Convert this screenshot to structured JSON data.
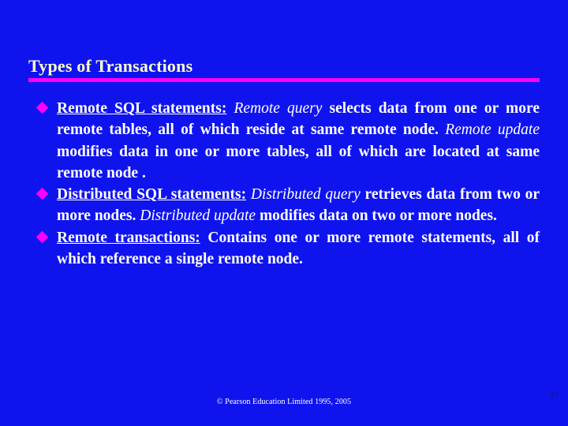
{
  "slide": {
    "background_color": "#0f14ef",
    "title": "Types of Transactions",
    "title_color": "#ffffcc",
    "rule_color": "#ff00ff",
    "bullet_marker_color": "#ff00ff",
    "body_text_color": "#ffffff",
    "bullets": [
      {
        "marker": "diamond-bullet",
        "term": "Remote  SQL  statements",
        "term_suffix": ":",
        "segments": [
          {
            "text": "Remote query",
            "style": "italic"
          },
          {
            "text": " selects data from one or more remote tables, all of which reside at same remote node. ",
            "style": "normal"
          },
          {
            "text": "Remote update",
            "style": "italic"
          },
          {
            "text": " modifies data in one or more tables, all of which are located at same remote node .",
            "style": "normal"
          }
        ]
      },
      {
        "marker": "diamond-bullet",
        "term": "Distributed  SQL  statements",
        "term_suffix": ":",
        "segments": [
          {
            "text": "Distributed query",
            "style": "italic"
          },
          {
            "text": " retrieves data from two or more nodes. ",
            "style": "normal"
          },
          {
            "text": "Distributed update",
            "style": "italic"
          },
          {
            "text": " modifies data on two or more nodes.",
            "style": "normal"
          }
        ]
      },
      {
        "marker": "diamond-bullet",
        "term": "Remote  transactions",
        "term_suffix": ":",
        "segments": [
          {
            "text": " Contains one or more remote statements, all of which reference a single remote node.",
            "style": "normal"
          }
        ]
      }
    ],
    "footer": {
      "copyright": "© Pearson Education Limited 1995, 2005",
      "page_number": "91"
    }
  }
}
